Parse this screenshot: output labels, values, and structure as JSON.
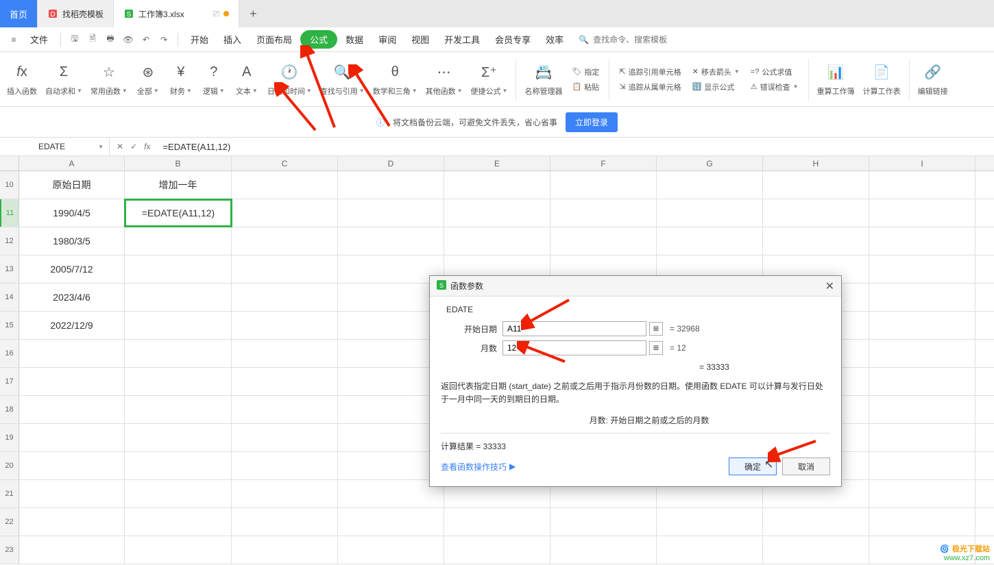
{
  "tabs": {
    "home": "首页",
    "mid": "找稻壳模板",
    "active": "工作簿3.xlsx"
  },
  "file_label": "文件",
  "menu": [
    "开始",
    "插入",
    "页面布局",
    "公式",
    "数据",
    "审阅",
    "视图",
    "开发工具",
    "会员专享",
    "效率"
  ],
  "menu_active_index": 3,
  "search_placeholder": "查找命令、搜索模板",
  "ribbon": {
    "insert_fn": "插入函数",
    "autosum": "自动求和",
    "common": "常用函数",
    "all": "全部",
    "finance": "财务",
    "logic": "逻辑",
    "text": "文本",
    "datetime": "日期和时间",
    "lookup": "查找与引用",
    "math": "数学和三角",
    "other": "其他函数",
    "quick": "便捷公式",
    "name_mgr": "名称管理器",
    "paste": "粘贴",
    "define": "指定",
    "trace_prec": "追踪引用单元格",
    "trace_dep": "追踪从属单元格",
    "remove_arrows": "移去箭头",
    "show_formula": "显示公式",
    "eval": "公式求值",
    "error_check": "错误检查",
    "recalc": "重算工作簿",
    "calc_sheet": "计算工作表",
    "edit_link": "编辑链接"
  },
  "banner": {
    "text": "将文档备份云端，可避免文件丢失，省心省事",
    "btn": "立即登录"
  },
  "name_box": "EDATE",
  "formula": "=EDATE(A11,12)",
  "columns": [
    "A",
    "B",
    "C",
    "D",
    "E",
    "F",
    "G",
    "H",
    "I"
  ],
  "rows": [
    "10",
    "11",
    "12",
    "13",
    "14",
    "15",
    "16",
    "17",
    "18",
    "19",
    "20",
    "21",
    "22",
    "23"
  ],
  "cells": {
    "A10": "原始日期",
    "B10": "增加一年",
    "A11": "1990/4/5",
    "B11": "=EDATE(A11,12)",
    "A12": "1980/3/5",
    "A13": "2005/7/12",
    "A14": "2023/4/6",
    "A15": "2022/12/9"
  },
  "dialog": {
    "title": "函数参数",
    "fn": "EDATE",
    "p1_label": "开始日期",
    "p1_value": "A11",
    "p1_result": "= 32968",
    "p2_label": "月数",
    "p2_value": "12",
    "p2_result": "= 12",
    "mid_result": "= 33333",
    "desc": "返回代表指定日期 (start_date) 之前或之后用于指示月份数的日期。使用函数 EDATE 可以计算与发行日处于一月中同一天的到期日的日期。",
    "sub": "月数:  开始日期之前或之后的月数",
    "calc_label": "计算结果 = 33333",
    "link": "查看函数操作技巧",
    "ok": "确定",
    "cancel": "取消"
  },
  "watermark": {
    "brand": "极光下载站",
    "url": "www.xz7.com"
  }
}
